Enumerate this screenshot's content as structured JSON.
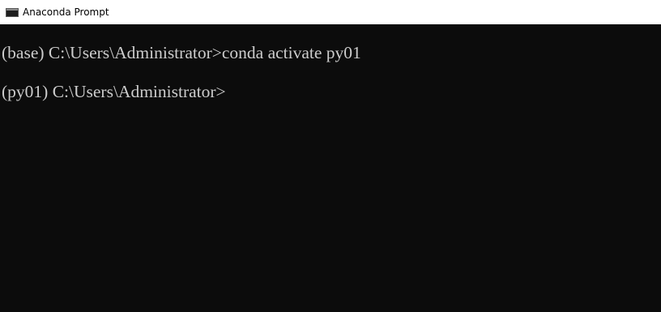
{
  "window": {
    "title": "Anaconda Prompt",
    "icon": "console-icon"
  },
  "console": {
    "lines": [
      {
        "prompt": "(base) C:\\Users\\Administrator>",
        "command": "conda activate py01"
      },
      {
        "prompt": "(py01) C:\\Users\\Administrator>",
        "command": ""
      }
    ]
  },
  "colors": {
    "background": "#0c0c0c",
    "text": "#cccccc",
    "titlebar": "#ffffff"
  }
}
